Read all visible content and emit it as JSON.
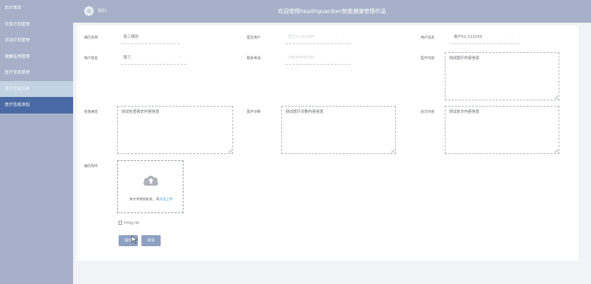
{
  "sidebar": {
    "items": [
      {
        "label": "后台首页"
      },
      {
        "label": "饮食计划管理"
      },
      {
        "label": "运动计划管理"
      },
      {
        "label": "健康监测管理"
      },
      {
        "label": "医疗信息管理"
      },
      {
        "label": "医疗信息列表"
      },
      {
        "label": "医疗信息添加"
      }
    ]
  },
  "header": {
    "title": "欢迎使用healthguardian智能健康管理作品",
    "user": "医生1"
  },
  "form": {
    "record_name": {
      "label": "病历名称",
      "value": "张三病历"
    },
    "doctor_user": {
      "label": "医生用户",
      "value": "医生1-222244"
    },
    "user_info": {
      "label": "用户信息",
      "value": "用户01-112233"
    },
    "user_name": {
      "label": "用户姓名",
      "value": "张三"
    },
    "phone": {
      "label": "联系电话",
      "value": "19644445555"
    },
    "medical_content": {
      "label": "医疗内容",
      "value": "测试医疗内容信息"
    },
    "symptom": {
      "label": "检查病史",
      "value": "测试检查病史内容信息"
    },
    "diagnosis": {
      "label": "医疗诊断",
      "value": "测试医疗诊断内容信息"
    },
    "prescription": {
      "label": "处方内容",
      "value": "测试处方内容信息"
    },
    "attachment": {
      "label": "病历附件",
      "hint": "将文件拖到此处，或",
      "link": "点击上传",
      "file": "timg.rar"
    },
    "submit_label": "提交",
    "cancel_label": "取消"
  },
  "colors": {
    "sidebar": "#a6b1c9",
    "sidebar_active": "#4a6aa5",
    "button": "#8ea1c3",
    "link": "#409eff"
  }
}
